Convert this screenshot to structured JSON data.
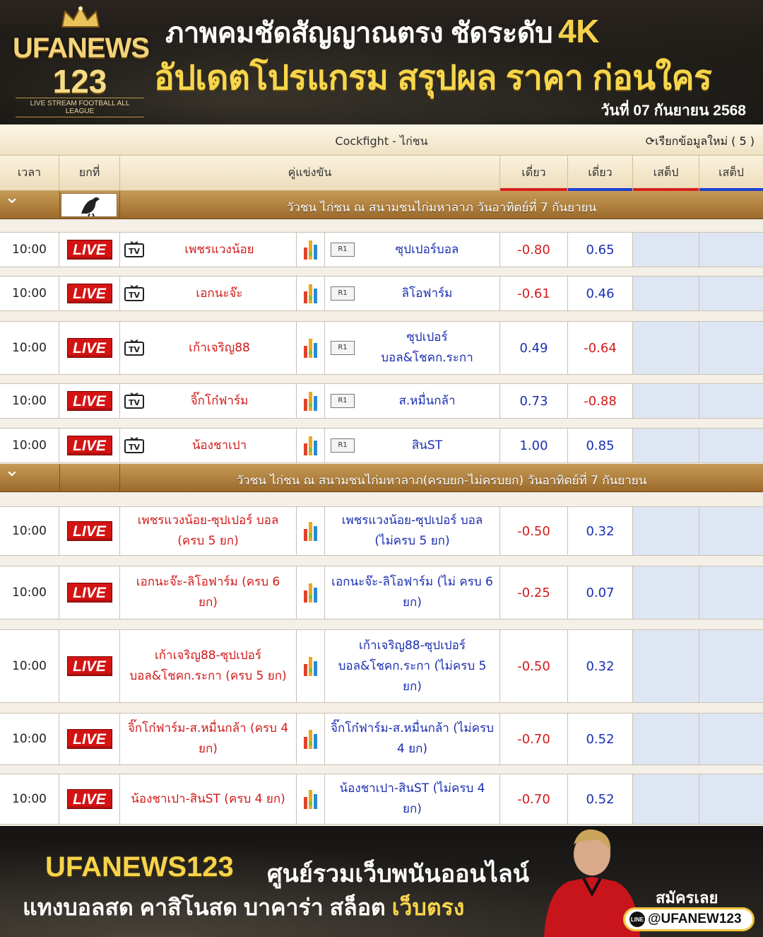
{
  "banner": {
    "logo_brand": "UFANEWS",
    "logo_number": "123",
    "logo_tagline": "LIVE STREAM FOOTBALL ALL LEAGUE",
    "headline_1": "ภาพคมชัดสัญญาณตรง ชัดระดับ",
    "headline_1_highlight": "4K",
    "headline_2": "อัปเดตโปรแกรม สรุปผล ราคา ก่อนใคร",
    "date_caption": "วันที่ 07 กันยายน 2568"
  },
  "board": {
    "title": "Cockfight - ไก่ชน",
    "refresh_label": "เรียกข้อมูลใหม่ ( 5 )",
    "columns": {
      "time": "เวลา",
      "round": "ยกที่",
      "match": "คู่แข่งขัน",
      "single1": "เดี่ยว",
      "single2": "เดี่ยว",
      "step1": "เสต็ป",
      "step2": "เสต็ป"
    },
    "leagues": [
      {
        "name": "วัวชน ไก่ชน ณ สนามชนไก่มหาลาภ วันอาทิตย์ที่ 7 กันยายน",
        "matches": [
          {
            "time": "10:00",
            "live": "LIVE",
            "home": "เพชรแวงน้อย",
            "away": "ซุปเปอร์บอล",
            "tag": "R1",
            "odd1": "-0.80",
            "odd2": "0.65"
          },
          {
            "time": "10:00",
            "live": "LIVE",
            "home": "เอกนะจ๊ะ",
            "away": "ลิโอฟาร์ม",
            "tag": "R1",
            "odd1": "-0.61",
            "odd2": "0.46"
          },
          {
            "time": "10:00",
            "live": "LIVE",
            "home": "เก้าเจริญ88",
            "away": "ซุปเปอร์ บอล&โชคก.ระกา",
            "tag": "R1",
            "odd1": "0.49",
            "odd2": "-0.64"
          },
          {
            "time": "10:00",
            "live": "LIVE",
            "home": "จิ๊กโก๋ฟาร์ม",
            "away": "ส.หมื่นกล้า",
            "tag": "R1",
            "odd1": "0.73",
            "odd2": "-0.88"
          },
          {
            "time": "10:00",
            "live": "LIVE",
            "home": "น้องชาเปา",
            "away": "สินST",
            "tag": "R1",
            "odd1": "1.00",
            "odd2": "0.85"
          }
        ]
      },
      {
        "name": "วัวชน ไก่ชน ณ สนามชนไก่มหาลาภ(ครบยก-ไม่ครบยก) วันอาทิตย์ที่ 7 กันยายน",
        "matches": [
          {
            "time": "10:00",
            "live": "LIVE",
            "home": "เพชรแวงน้อย-ซุปเปอร์ บอล (ครบ 5 ยก)",
            "away": "เพชรแวงน้อย-ซุปเปอร์ บอล (ไม่ครบ 5 ยก)",
            "odd1": "-0.50",
            "odd2": "0.32"
          },
          {
            "time": "10:00",
            "live": "LIVE",
            "home": "เอกนะจ๊ะ-ลิโอฟาร์ม (ครบ 6 ยก)",
            "away": "เอกนะจ๊ะ-ลิโอฟาร์ม (ไม่ ครบ 6 ยก)",
            "odd1": "-0.25",
            "odd2": "0.07"
          },
          {
            "time": "10:00",
            "live": "LIVE",
            "home": "เก้าเจริญ88-ซุปเปอร์ บอล&โชคก.ระกา (ครบ 5 ยก)",
            "away": "เก้าเจริญ88-ซุปเปอร์ บอล&โชคก.ระกา (ไม่ครบ 5 ยก)",
            "odd1": "-0.50",
            "odd2": "0.32"
          },
          {
            "time": "10:00",
            "live": "LIVE",
            "home": "จิ๊กโก๋ฟาร์ม-ส.หมื่นกล้า (ครบ 4 ยก)",
            "away": "จิ๊กโก๋ฟาร์ม-ส.หมื่นกล้า (ไม่ครบ 4 ยก)",
            "odd1": "-0.70",
            "odd2": "0.52"
          },
          {
            "time": "10:00",
            "live": "LIVE",
            "home": "น้องชาเปา-สินST (ครบ 4 ยก)",
            "away": "น้องชาเปา-สินST (ไม่ครบ 4 ยก)",
            "odd1": "-0.70",
            "odd2": "0.52"
          }
        ]
      }
    ]
  },
  "footer": {
    "brand": "UFANEWS123",
    "slogan": "ศูนย์รวมเว็บพนันออนไลน์",
    "line2": "แทงบอลสด คาสิโนสด บาคาร่า สล็อต",
    "line2_highlight": "เว็บตรง",
    "signup": "สมัครเลย",
    "line_id": "@UFANEW123"
  },
  "colors": {
    "accent_gold": "#f6d34a",
    "league_bar": "#b0803f",
    "home_team": "#d21a1a",
    "away_team": "#1b2fb0",
    "live_badge": "#d41313"
  }
}
